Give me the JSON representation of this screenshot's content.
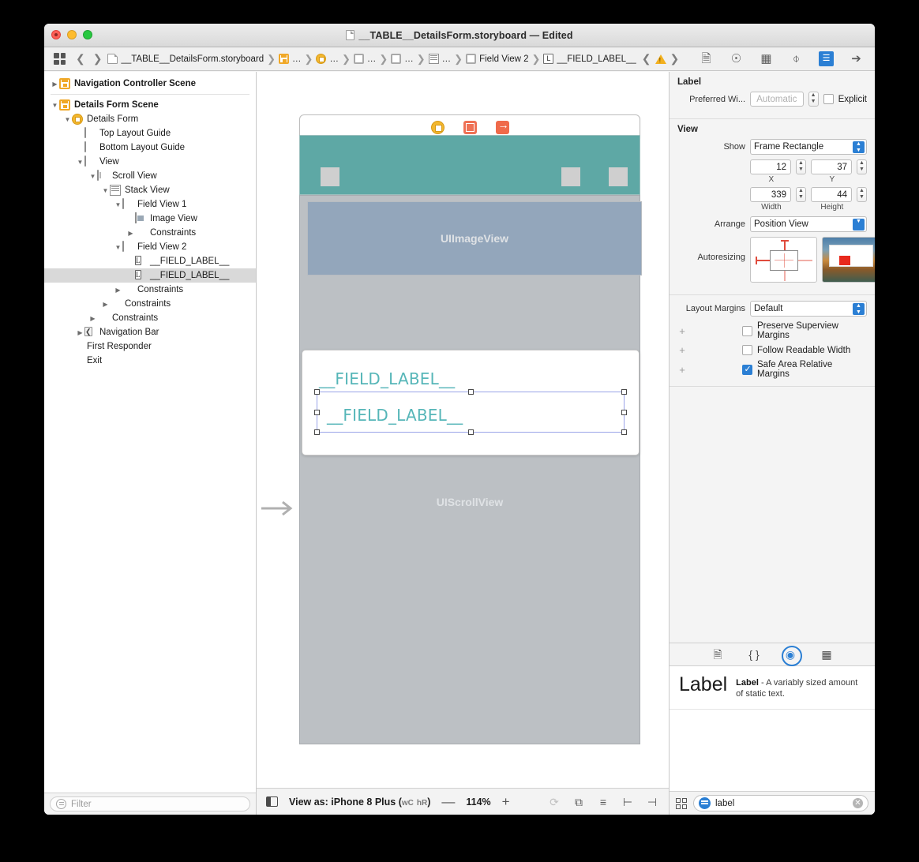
{
  "window": {
    "title": "__TABLE__DetailsForm.storyboard — Edited",
    "doc_icon": "document-icon"
  },
  "breadcrumb": {
    "grid_icon": "grid-icon",
    "back_icon": "chevron-left-icon",
    "forward_icon": "chevron-right-icon",
    "items": [
      {
        "icon": "storyboard-file-icon",
        "label": "__TABLE__DetailsForm.storyboard"
      },
      {
        "icon": "scene-icon",
        "label": "…"
      },
      {
        "icon": "view-controller-icon",
        "label": "…"
      },
      {
        "icon": "view-icon",
        "label": "…"
      },
      {
        "icon": "view-icon",
        "label": "…"
      },
      {
        "icon": "stack-view-icon",
        "label": "…"
      },
      {
        "icon": "view-icon",
        "label": "Field View 2"
      },
      {
        "icon": "label-icon",
        "label": "__FIELD_LABEL__"
      }
    ],
    "issue_prev_icon": "chevron-left-icon",
    "issue_icon": "warning-triangle-icon",
    "issue_next_icon": "chevron-right-icon"
  },
  "inspector_tabs": [
    {
      "name": "file-inspector-tab",
      "glyph": "὜B",
      "active": false
    },
    {
      "name": "quick-help-inspector-tab",
      "glyph": "?",
      "active": false
    },
    {
      "name": "identity-inspector-tab",
      "glyph": "▤",
      "active": false
    },
    {
      "name": "attributes-inspector-tab",
      "glyph": "⬇",
      "active": false
    },
    {
      "name": "size-inspector-tab",
      "glyph": "‖",
      "active": true
    },
    {
      "name": "connections-inspector-tab",
      "glyph": "→",
      "active": false
    }
  ],
  "navigator": {
    "tree": [
      {
        "depth": 0,
        "twisty": "closed",
        "icon": "scene-icon",
        "label": "Navigation Controller Scene",
        "bold": true,
        "selected": false
      },
      {
        "separator": true
      },
      {
        "depth": 0,
        "twisty": "open",
        "icon": "scene-icon",
        "label": "Details Form Scene",
        "bold": true,
        "selected": false,
        "badge": "stop-badge"
      },
      {
        "depth": 1,
        "twisty": "open",
        "icon": "view-controller-icon",
        "label": "Details Form",
        "selected": false
      },
      {
        "depth": 2,
        "twisty": "none",
        "icon": "top-layout-guide-icon",
        "label": "Top Layout Guide",
        "selected": false
      },
      {
        "depth": 2,
        "twisty": "none",
        "icon": "bottom-layout-guide-icon",
        "label": "Bottom Layout Guide",
        "selected": false
      },
      {
        "depth": 2,
        "twisty": "open",
        "icon": "view-icon",
        "label": "View",
        "selected": false
      },
      {
        "depth": 3,
        "twisty": "open",
        "icon": "scroll-view-icon",
        "label": "Scroll View",
        "selected": false
      },
      {
        "depth": 4,
        "twisty": "open",
        "icon": "stack-view-icon",
        "label": "Stack View",
        "selected": false
      },
      {
        "depth": 5,
        "twisty": "open",
        "icon": "view-icon",
        "label": "Field View 1",
        "selected": false
      },
      {
        "depth": 6,
        "twisty": "none",
        "icon": "image-view-icon",
        "label": "Image View",
        "selected": false
      },
      {
        "depth": 6,
        "twisty": "closed",
        "icon": "constraints-icon",
        "label": "Constraints",
        "selected": false
      },
      {
        "depth": 5,
        "twisty": "open",
        "icon": "view-icon",
        "label": "Field View 2",
        "selected": false
      },
      {
        "depth": 6,
        "twisty": "none",
        "icon": "label-icon",
        "label": "__FIELD_LABEL__",
        "selected": false
      },
      {
        "depth": 6,
        "twisty": "none",
        "icon": "label-icon",
        "label": "__FIELD_LABEL__",
        "selected": true
      },
      {
        "depth": 5,
        "twisty": "closed",
        "icon": "constraints-icon",
        "label": "Constraints",
        "selected": false
      },
      {
        "depth": 4,
        "twisty": "closed",
        "icon": "constraints-icon",
        "label": "Constraints",
        "selected": false
      },
      {
        "depth": 3,
        "twisty": "closed",
        "icon": "constraints-icon",
        "label": "Constraints",
        "selected": false
      },
      {
        "depth": 2,
        "twisty": "closed",
        "icon": "navigation-bar-icon",
        "label": "Navigation Bar",
        "selected": false
      },
      {
        "depth": 1,
        "twisty": "none",
        "icon": "first-responder-icon",
        "label": "First Responder",
        "selected": false
      },
      {
        "depth": 1,
        "twisty": "none",
        "icon": "exit-icon",
        "label": "Exit",
        "selected": false
      }
    ],
    "filter_placeholder": "Filter",
    "filter_icon": "filter-icon"
  },
  "canvas": {
    "dock_icons": [
      {
        "name": "view-controller-dock-icon"
      },
      {
        "name": "first-responder-dock-icon"
      },
      {
        "name": "exit-dock-icon"
      }
    ],
    "image_view_placeholder": "UIImageView",
    "scroll_view_placeholder": "UIScrollView",
    "field_labels": [
      "__FIELD_LABEL__",
      "__FIELD_LABEL__"
    ],
    "entry_arrow_icon": "entry-point-arrow-icon",
    "navbar_color": "#5ea8a5",
    "label_color": "#56b6b8",
    "selection_color": "#9aa4e8"
  },
  "canvas_toolbar": {
    "panel_toggle_icon": "bottom-panel-toggle-icon",
    "view_as_label": "View as: iPhone 8 Plus (",
    "trait_w": "wC",
    "trait_h": "hR",
    "view_as_close": ")",
    "zoom_out_label": "—",
    "zoom_level": "114%",
    "zoom_in_label": "+",
    "tools": [
      {
        "name": "update-frames-icon",
        "glyph": "⟳",
        "dim": true
      },
      {
        "name": "embed-in-icon",
        "glyph": "⧉",
        "dim": false
      },
      {
        "name": "align-icon",
        "glyph": "≡",
        "dim": false
      },
      {
        "name": "add-constraints-icon",
        "glyph": "⊢",
        "dim": false
      },
      {
        "name": "resolve-auto-layout-icon",
        "glyph": "⊣",
        "dim": false
      }
    ]
  },
  "inspector": {
    "label_section": {
      "title": "Label",
      "preferred_width_label": "Preferred Wi...",
      "preferred_width_value": "Automatic",
      "explicit_label": "Explicit",
      "explicit_checked": false
    },
    "view_section": {
      "title": "View",
      "show_label": "Show",
      "show_value": "Frame Rectangle",
      "x_value": "12",
      "x_label": "X",
      "y_value": "37",
      "y_label": "Y",
      "width_value": "339",
      "width_label": "Width",
      "height_value": "44",
      "height_label": "Height",
      "arrange_label": "Arrange",
      "arrange_value": "Position View",
      "autoresizing_label": "Autoresizing",
      "layout_margins_label": "Layout Margins",
      "layout_margins_value": "Default",
      "checkboxes": [
        {
          "label": "Preserve Superview Margins",
          "checked": false
        },
        {
          "label": "Follow Readable Width",
          "checked": false
        },
        {
          "label": "Safe Area Relative Margins",
          "checked": true
        }
      ]
    }
  },
  "library": {
    "tabs": [
      {
        "name": "file-template-library-tab",
        "glyph": "὜B",
        "active": false
      },
      {
        "name": "code-snippet-library-tab",
        "glyph": "{ }",
        "active": false
      },
      {
        "name": "object-library-tab",
        "glyph": "◎",
        "active": true
      },
      {
        "name": "media-library-tab",
        "glyph": "▤",
        "active": false
      }
    ],
    "item": {
      "glyph_text": "Label",
      "name": "Label",
      "description": " - A variably sized amount of static text."
    },
    "filter_value": "label",
    "filter_icon": "filter-icon",
    "clear_icon": "clear-icon",
    "grid_icon": "grid-icon"
  }
}
